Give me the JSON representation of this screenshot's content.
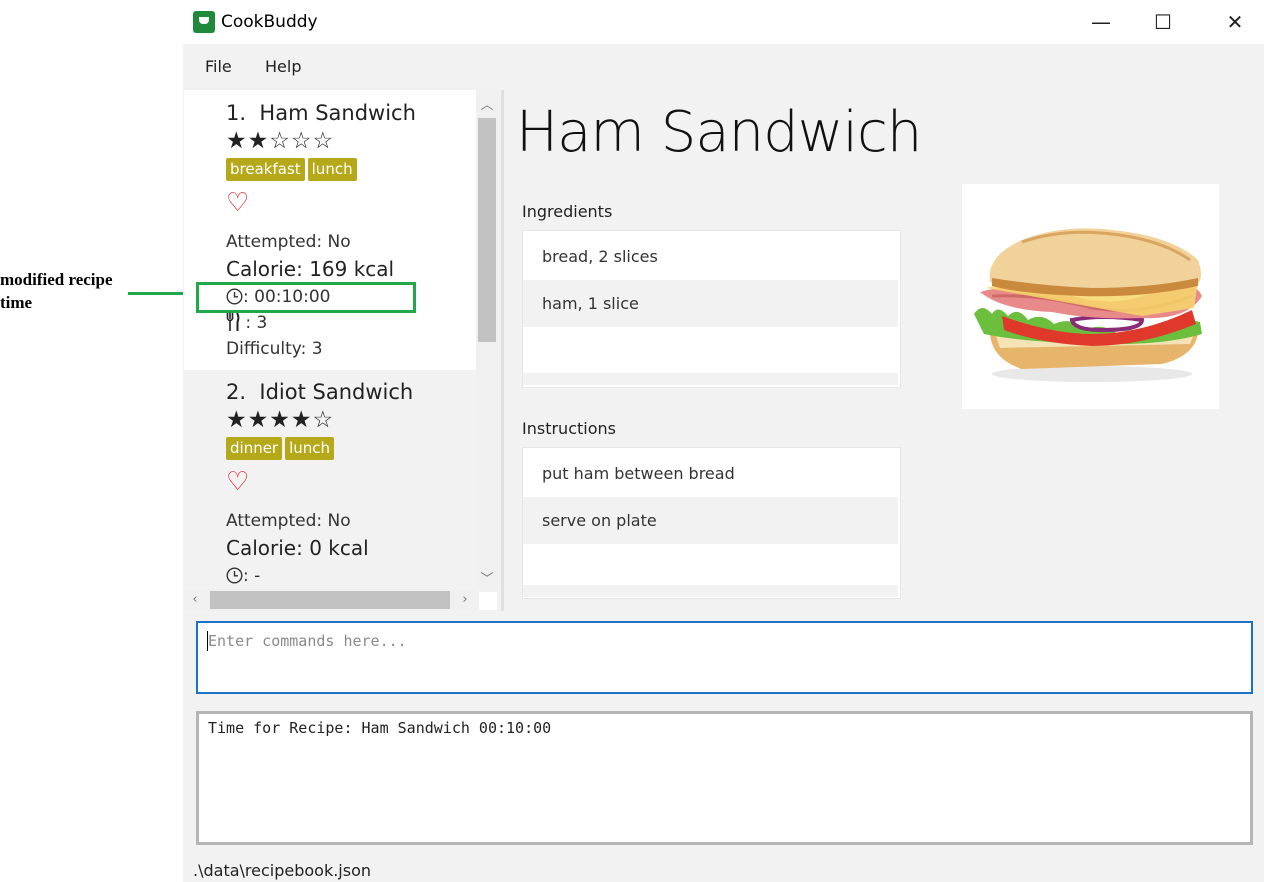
{
  "annotation": {
    "label_line1": "modified recipe",
    "label_line2": "time",
    "color": "#22a84a"
  },
  "window": {
    "title": "CookBuddy",
    "icon": "chef-hat-icon",
    "controls": {
      "minimize": "—",
      "maximize": "☐",
      "close": "✕"
    }
  },
  "menu": {
    "file": "File",
    "help": "Help"
  },
  "recipes": [
    {
      "index": "1.",
      "name": "Ham Sandwich",
      "stars": "★★☆☆☆",
      "rating": 2,
      "tags": [
        "breakfast",
        "lunch"
      ],
      "favorite_glyph": "♡",
      "attempted": "Attempted: No",
      "calorie": "Calorie: 169 kcal",
      "time": ": 00:10:00",
      "servings": " : 3",
      "difficulty": "Difficulty: 3"
    },
    {
      "index": "2.",
      "name": "Idiot Sandwich",
      "stars": "★★★★☆",
      "rating": 4,
      "tags": [
        "dinner",
        "lunch"
      ],
      "favorite_glyph": "♡",
      "attempted": "Attempted: No",
      "calorie": "Calorie: 0 kcal",
      "time": ": -"
    }
  ],
  "detail": {
    "title": "Ham Sandwich",
    "ingredients_label": "Ingredients",
    "ingredients": [
      "bread, 2 slices",
      "ham, 1 slice"
    ],
    "instructions_label": "Instructions",
    "instructions": [
      "put ham between bread",
      "serve on plate"
    ],
    "image": "sandwich-image"
  },
  "command": {
    "placeholder": "Enter commands here...",
    "value": ""
  },
  "result": {
    "text": "Time for Recipe: Ham Sandwich 00:10:00"
  },
  "status": {
    "path": ".\\data\\recipebook.json"
  },
  "colors": {
    "tag": "#b5a91a",
    "heart": "#e0242b",
    "command_border": "#1a73c9",
    "app_icon": "#1f8a3a"
  }
}
